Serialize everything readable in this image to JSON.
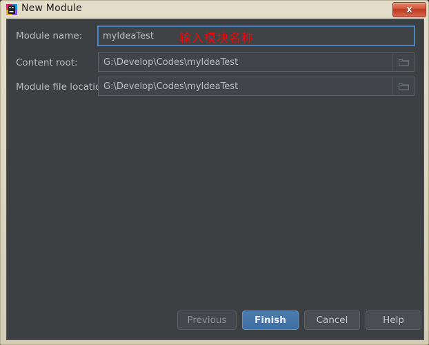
{
  "window": {
    "title": "New Module",
    "icon": "intellij-idea-icon",
    "close_label": "x",
    "frame_color": "#ddd6c0",
    "body_color": "#3c4043"
  },
  "form": {
    "rows": [
      {
        "label": "Module name:",
        "value": "myIdeaTest",
        "has_browse": false,
        "focused": true,
        "browse_icon": ""
      },
      {
        "label": "Content root:",
        "value": "G:\\Develop\\Codes\\myIdeaTest",
        "has_browse": true,
        "focused": false,
        "browse_icon": "folder-icon"
      },
      {
        "label": "Module file location:",
        "value": "G:\\Develop\\Codes\\myIdeaTest",
        "has_browse": true,
        "focused": false,
        "browse_icon": "folder-icon"
      }
    ]
  },
  "annotation": {
    "text": "输入模块名称",
    "color": "#ff0000"
  },
  "buttons": [
    {
      "label": "Previous",
      "state": "disabled"
    },
    {
      "label": "Finish",
      "state": "default"
    },
    {
      "label": "Cancel",
      "state": "normal"
    },
    {
      "label": "Help",
      "state": "normal"
    }
  ]
}
